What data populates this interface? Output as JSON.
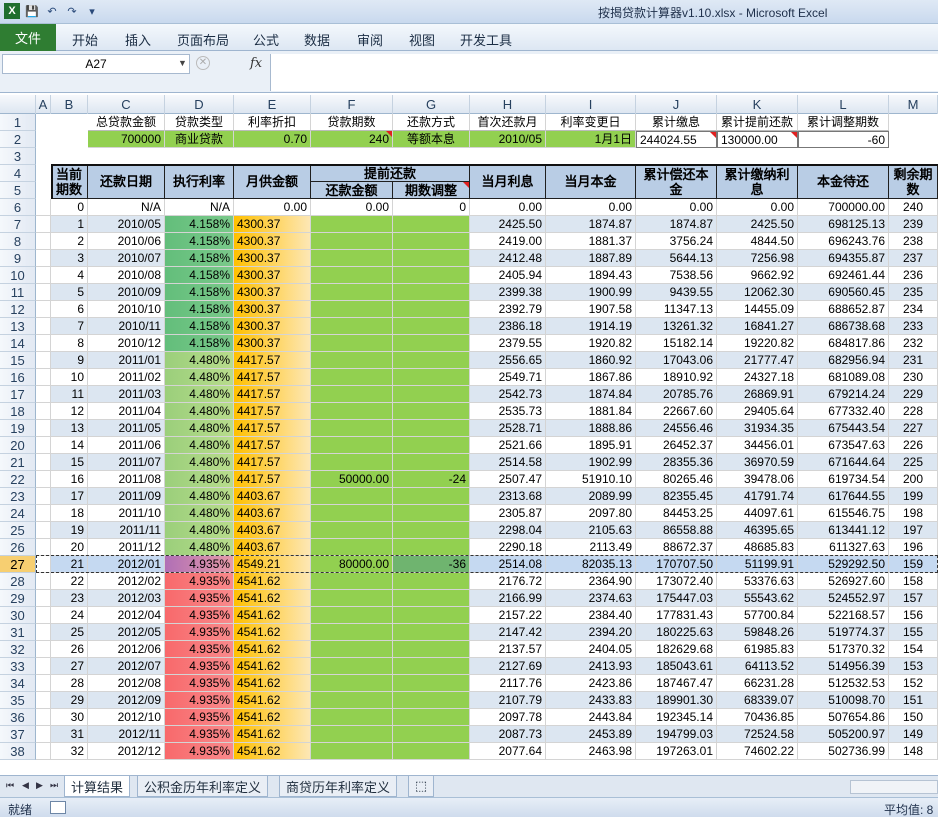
{
  "window": {
    "title": "按揭贷款计算器v1.10.xlsx - Microsoft Excel"
  },
  "ribbon": {
    "file": "文件",
    "tabs": [
      "开始",
      "插入",
      "页面布局",
      "公式",
      "数据",
      "审阅",
      "视图",
      "开发工具"
    ]
  },
  "formula_bar": {
    "name_box": "A27",
    "fx": "fx",
    "formula": ""
  },
  "columns": [
    "A",
    "B",
    "C",
    "D",
    "E",
    "F",
    "G",
    "H",
    "I",
    "J",
    "K",
    "L",
    "M"
  ],
  "summary": {
    "labels": [
      "总贷款金额",
      "贷款类型",
      "利率折扣",
      "贷款期数",
      "还款方式",
      "首次还款月",
      "利率变更日",
      "累计缴息",
      "累计提前还款",
      "累计调整期数"
    ],
    "values": [
      "700000",
      "商业贷款",
      "0.70",
      "240",
      "等额本息",
      "2010/05",
      "1月1日",
      "244024.55",
      "130000.00",
      "-60"
    ]
  },
  "table_headers": {
    "period": "当前期数",
    "date": "还款日期",
    "rate": "执行利率",
    "payment": "月供金额",
    "prepay": "提前还款",
    "prepay_amount": "还款金额",
    "period_adjust": "期数调整",
    "interest": "当月利息",
    "principal": "当月本金",
    "cum_principal": "累计偿还本金",
    "cum_interest": "累计缴纳利息",
    "balance": "本金待还",
    "remaining": "剩余期数"
  },
  "rows": [
    [
      "0",
      "N/A",
      "N/A",
      "0.00",
      "0.00",
      "0",
      "0.00",
      "0.00",
      "0.00",
      "0.00",
      "700000.00",
      "240"
    ],
    [
      "1",
      "2010/05",
      "4.158%",
      "4300.37",
      "",
      "",
      "2425.50",
      "1874.87",
      "1874.87",
      "2425.50",
      "698125.13",
      "239"
    ],
    [
      "2",
      "2010/06",
      "4.158%",
      "4300.37",
      "",
      "",
      "2419.00",
      "1881.37",
      "3756.24",
      "4844.50",
      "696243.76",
      "238"
    ],
    [
      "3",
      "2010/07",
      "4.158%",
      "4300.37",
      "",
      "",
      "2412.48",
      "1887.89",
      "5644.13",
      "7256.98",
      "694355.87",
      "237"
    ],
    [
      "4",
      "2010/08",
      "4.158%",
      "4300.37",
      "",
      "",
      "2405.94",
      "1894.43",
      "7538.56",
      "9662.92",
      "692461.44",
      "236"
    ],
    [
      "5",
      "2010/09",
      "4.158%",
      "4300.37",
      "",
      "",
      "2399.38",
      "1900.99",
      "9439.55",
      "12062.30",
      "690560.45",
      "235"
    ],
    [
      "6",
      "2010/10",
      "4.158%",
      "4300.37",
      "",
      "",
      "2392.79",
      "1907.58",
      "11347.13",
      "14455.09",
      "688652.87",
      "234"
    ],
    [
      "7",
      "2010/11",
      "4.158%",
      "4300.37",
      "",
      "",
      "2386.18",
      "1914.19",
      "13261.32",
      "16841.27",
      "686738.68",
      "233"
    ],
    [
      "8",
      "2010/12",
      "4.158%",
      "4300.37",
      "",
      "",
      "2379.55",
      "1920.82",
      "15182.14",
      "19220.82",
      "684817.86",
      "232"
    ],
    [
      "9",
      "2011/01",
      "4.480%",
      "4417.57",
      "",
      "",
      "2556.65",
      "1860.92",
      "17043.06",
      "21777.47",
      "682956.94",
      "231"
    ],
    [
      "10",
      "2011/02",
      "4.480%",
      "4417.57",
      "",
      "",
      "2549.71",
      "1867.86",
      "18910.92",
      "24327.18",
      "681089.08",
      "230"
    ],
    [
      "11",
      "2011/03",
      "4.480%",
      "4417.57",
      "",
      "",
      "2542.73",
      "1874.84",
      "20785.76",
      "26869.91",
      "679214.24",
      "229"
    ],
    [
      "12",
      "2011/04",
      "4.480%",
      "4417.57",
      "",
      "",
      "2535.73",
      "1881.84",
      "22667.60",
      "29405.64",
      "677332.40",
      "228"
    ],
    [
      "13",
      "2011/05",
      "4.480%",
      "4417.57",
      "",
      "",
      "2528.71",
      "1888.86",
      "24556.46",
      "31934.35",
      "675443.54",
      "227"
    ],
    [
      "14",
      "2011/06",
      "4.480%",
      "4417.57",
      "",
      "",
      "2521.66",
      "1895.91",
      "26452.37",
      "34456.01",
      "673547.63",
      "226"
    ],
    [
      "15",
      "2011/07",
      "4.480%",
      "4417.57",
      "",
      "",
      "2514.58",
      "1902.99",
      "28355.36",
      "36970.59",
      "671644.64",
      "225"
    ],
    [
      "16",
      "2011/08",
      "4.480%",
      "4417.57",
      "50000.00",
      "-24",
      "2507.47",
      "51910.10",
      "80265.46",
      "39478.06",
      "619734.54",
      "200"
    ],
    [
      "17",
      "2011/09",
      "4.480%",
      "4403.67",
      "",
      "",
      "2313.68",
      "2089.99",
      "82355.45",
      "41791.74",
      "617644.55",
      "199"
    ],
    [
      "18",
      "2011/10",
      "4.480%",
      "4403.67",
      "",
      "",
      "2305.87",
      "2097.80",
      "84453.25",
      "44097.61",
      "615546.75",
      "198"
    ],
    [
      "19",
      "2011/11",
      "4.480%",
      "4403.67",
      "",
      "",
      "2298.04",
      "2105.63",
      "86558.88",
      "46395.65",
      "613441.12",
      "197"
    ],
    [
      "20",
      "2011/12",
      "4.480%",
      "4403.67",
      "",
      "",
      "2290.18",
      "2113.49",
      "88672.37",
      "48685.83",
      "611327.63",
      "196"
    ],
    [
      "21",
      "2012/01",
      "4.935%",
      "4549.21",
      "80000.00",
      "-36",
      "2514.08",
      "82035.13",
      "170707.50",
      "51199.91",
      "529292.50",
      "159"
    ],
    [
      "22",
      "2012/02",
      "4.935%",
      "4541.62",
      "",
      "",
      "2176.72",
      "2364.90",
      "173072.40",
      "53376.63",
      "526927.60",
      "158"
    ],
    [
      "23",
      "2012/03",
      "4.935%",
      "4541.62",
      "",
      "",
      "2166.99",
      "2374.63",
      "175447.03",
      "55543.62",
      "524552.97",
      "157"
    ],
    [
      "24",
      "2012/04",
      "4.935%",
      "4541.62",
      "",
      "",
      "2157.22",
      "2384.40",
      "177831.43",
      "57700.84",
      "522168.57",
      "156"
    ],
    [
      "25",
      "2012/05",
      "4.935%",
      "4541.62",
      "",
      "",
      "2147.42",
      "2394.20",
      "180225.63",
      "59848.26",
      "519774.37",
      "155"
    ],
    [
      "26",
      "2012/06",
      "4.935%",
      "4541.62",
      "",
      "",
      "2137.57",
      "2404.05",
      "182629.68",
      "61985.83",
      "517370.32",
      "154"
    ],
    [
      "27",
      "2012/07",
      "4.935%",
      "4541.62",
      "",
      "",
      "2127.69",
      "2413.93",
      "185043.61",
      "64113.52",
      "514956.39",
      "153"
    ],
    [
      "28",
      "2012/08",
      "4.935%",
      "4541.62",
      "",
      "",
      "2117.76",
      "2423.86",
      "187467.47",
      "66231.28",
      "512532.53",
      "152"
    ],
    [
      "29",
      "2012/09",
      "4.935%",
      "4541.62",
      "",
      "",
      "2107.79",
      "2433.83",
      "189901.30",
      "68339.07",
      "510098.70",
      "151"
    ],
    [
      "30",
      "2012/10",
      "4.935%",
      "4541.62",
      "",
      "",
      "2097.78",
      "2443.84",
      "192345.14",
      "70436.85",
      "507654.86",
      "150"
    ],
    [
      "31",
      "2012/11",
      "4.935%",
      "4541.62",
      "",
      "",
      "2087.73",
      "2453.89",
      "194799.03",
      "72524.58",
      "505200.97",
      "149"
    ],
    [
      "32",
      "2012/12",
      "4.935%",
      "4541.62",
      "",
      "",
      "2077.64",
      "2463.98",
      "197263.01",
      "74602.22",
      "502736.99",
      "148"
    ]
  ],
  "row_numbers": [
    "1",
    "2",
    "3",
    "4",
    "5",
    "6",
    "7",
    "8",
    "9",
    "10",
    "11",
    "12",
    "13",
    "14",
    "15",
    "16",
    "17",
    "18",
    "19",
    "20",
    "21",
    "22",
    "23",
    "24",
    "25",
    "26",
    "27",
    "28",
    "29",
    "30",
    "31",
    "32",
    "33",
    "34",
    "35",
    "36",
    "37",
    "38"
  ],
  "sheet_tabs": [
    "计算结果",
    "公积金历年利率定义",
    "商贷历年利率定义"
  ],
  "status": {
    "ready": "就绪",
    "average": "平均值: 8"
  },
  "colors": {
    "green": "#92d050",
    "header_blue": "#b9cde5",
    "rate_green": "#63be7b",
    "rate_yellow_green": "#9bcf7b",
    "rate_pink": "#e69ba8",
    "rate_red": "#f8696b",
    "payment_orange": "#ffc000",
    "row_alt": "#dce6f1",
    "selected_row": "#c5d9f1"
  }
}
